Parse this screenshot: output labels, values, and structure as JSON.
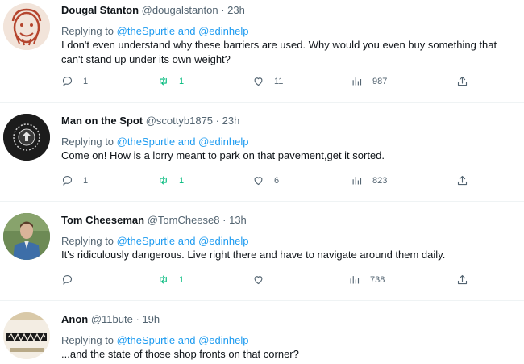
{
  "colors": {
    "accent": "#1d9bf0",
    "retweet": "#00ba7c",
    "muted": "#536471"
  },
  "replying_label": "Replying to",
  "and_label": "and",
  "tweets": [
    {
      "name": "Dougal Stanton",
      "handle": "@dougalstanton",
      "dot": "·",
      "time": "23h",
      "mention1": "@theSpurtle",
      "mention2": "@edinhelp",
      "text": "I don't even understand why these barriers are used. Why would you even buy something that can't stand up under its own weight?",
      "replies": "1",
      "retweets": "1",
      "likes": "11",
      "views": "987"
    },
    {
      "name": "Man on the Spot",
      "handle": "@scottyb1875",
      "dot": "·",
      "time": "23h",
      "mention1": "@theSpurtle",
      "mention2": "@edinhelp",
      "text": "Come on! How is a lorry meant to park on that pavement,get it sorted.",
      "replies": "1",
      "retweets": "1",
      "likes": "6",
      "views": "823"
    },
    {
      "name": "Tom Cheeseman",
      "handle": "@TomCheese8",
      "dot": "·",
      "time": "13h",
      "mention1": "@theSpurtle",
      "mention2": "@edinhelp",
      "text": "It's ridiculously dangerous. Live right there and have to navigate around them daily.",
      "replies": "",
      "retweets": "1",
      "likes": "",
      "views": "738"
    },
    {
      "name": "Anon",
      "handle": "@11bute",
      "dot": "·",
      "time": "19h",
      "mention1": "@theSpurtle",
      "mention2": "@edinhelp",
      "text": "...and the state of those shop fronts on that corner?"
    }
  ]
}
